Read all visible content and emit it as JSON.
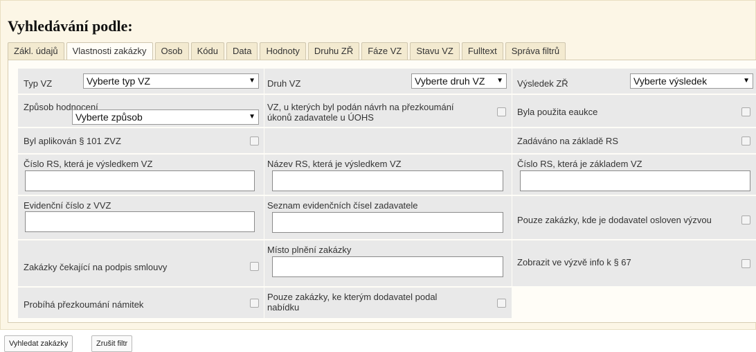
{
  "title": "Vyhledávání podle:",
  "tabs": [
    "Zákl. údajů",
    "Vlastnosti zakázky",
    "Osob",
    "Kódu",
    "Data",
    "Hodnoty",
    "Druhu ZŘ",
    "Fáze VZ",
    "Stavu VZ",
    "Fulltext",
    "Správa filtrů"
  ],
  "active_tab": "Vlastnosti zakázky",
  "fields": {
    "typ_vz": {
      "label": "Typ VZ",
      "value": "Vyberte typ VZ"
    },
    "druh_vz": {
      "label": "Druh VZ",
      "value": "Vyberte druh VZ"
    },
    "vysledek_zr": {
      "label": "Výsledek ZŘ",
      "value": "Vyberte výsledek"
    },
    "zpusob_hodnoceni": {
      "label": "Způsob hodnocení",
      "value": "Vyberte způsob"
    },
    "navrh_uohs": {
      "label": "VZ, u kterých byl podán návrh na přezkoumání úkonů zadavatele u ÚOHS",
      "checked": false
    },
    "eaukce": {
      "label": "Byla použita eaukce",
      "checked": false
    },
    "par101": {
      "label": "Byl aplikován § 101 ZVZ",
      "checked": false
    },
    "zaklad_rs": {
      "label": "Zadáváno na základě RS",
      "checked": false
    },
    "cislo_rs_vysledek": {
      "label": "Číslo RS, která je výsledkem VZ",
      "value": ""
    },
    "nazev_rs_vysledek": {
      "label": "Název RS, která je výsledkem VZ",
      "value": ""
    },
    "cislo_rs_zaklad": {
      "label": "Číslo RS, která je základem VZ",
      "value": ""
    },
    "evidencni_cislo": {
      "label": "Evidenční číslo z VVZ",
      "value": ""
    },
    "seznam_cisel": {
      "label": "Seznam evidenčních čísel zadavatele",
      "value": ""
    },
    "osloven_vyzvou": {
      "label": "Pouze zakázky, kde je dodavatel osloven výzvou",
      "checked": false
    },
    "cekajici_podpis": {
      "label": "Zakázky čekající na podpis smlouvy",
      "checked": false
    },
    "misto_plneni": {
      "label": "Místo plnění zakázky",
      "value": ""
    },
    "info_67": {
      "label": "Zobrazit ve výzvě info k § 67",
      "checked": false
    },
    "prezkoumani_namitek": {
      "label": "Probíhá přezkoumání námitek",
      "checked": false
    },
    "podal_nabidku": {
      "label": "Pouze zakázky, ke kterým dodavatel podal nabídku",
      "checked": false
    }
  },
  "buttons": {
    "search": "Vyhledat zakázky",
    "clear": "Zrušit filtr"
  }
}
